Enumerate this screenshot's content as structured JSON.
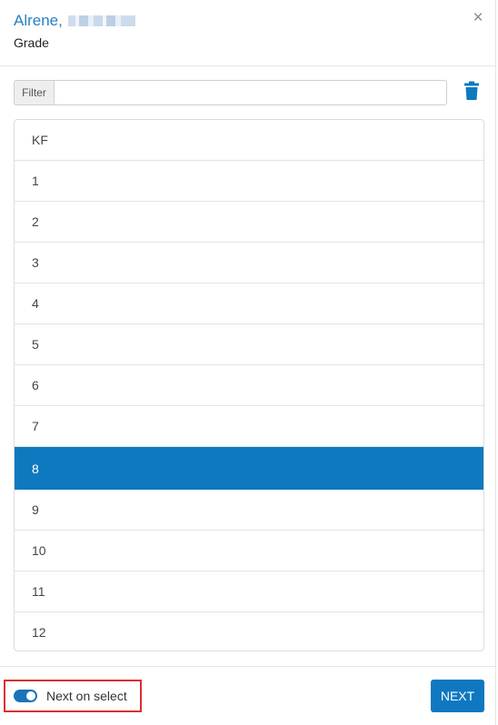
{
  "header": {
    "name": "Alrene,",
    "subtitle": "Grade",
    "close_symbol": "×"
  },
  "filter": {
    "label": "Filter",
    "value": "",
    "placeholder": ""
  },
  "grades": {
    "items": [
      "KF",
      "1",
      "2",
      "3",
      "4",
      "5",
      "6",
      "7",
      "8",
      "9",
      "10",
      "11",
      "12"
    ],
    "selected": "8"
  },
  "footer": {
    "toggle_label": "Next on select",
    "toggle_on": true,
    "next_label": "NEXT"
  },
  "colors": {
    "accent": "#0f79bf",
    "name_text": "#2a7fc0",
    "highlight_border": "#d93030"
  },
  "icons": {
    "close": "close-icon",
    "delete": "trash-icon",
    "toggle": "toggle-switch"
  }
}
